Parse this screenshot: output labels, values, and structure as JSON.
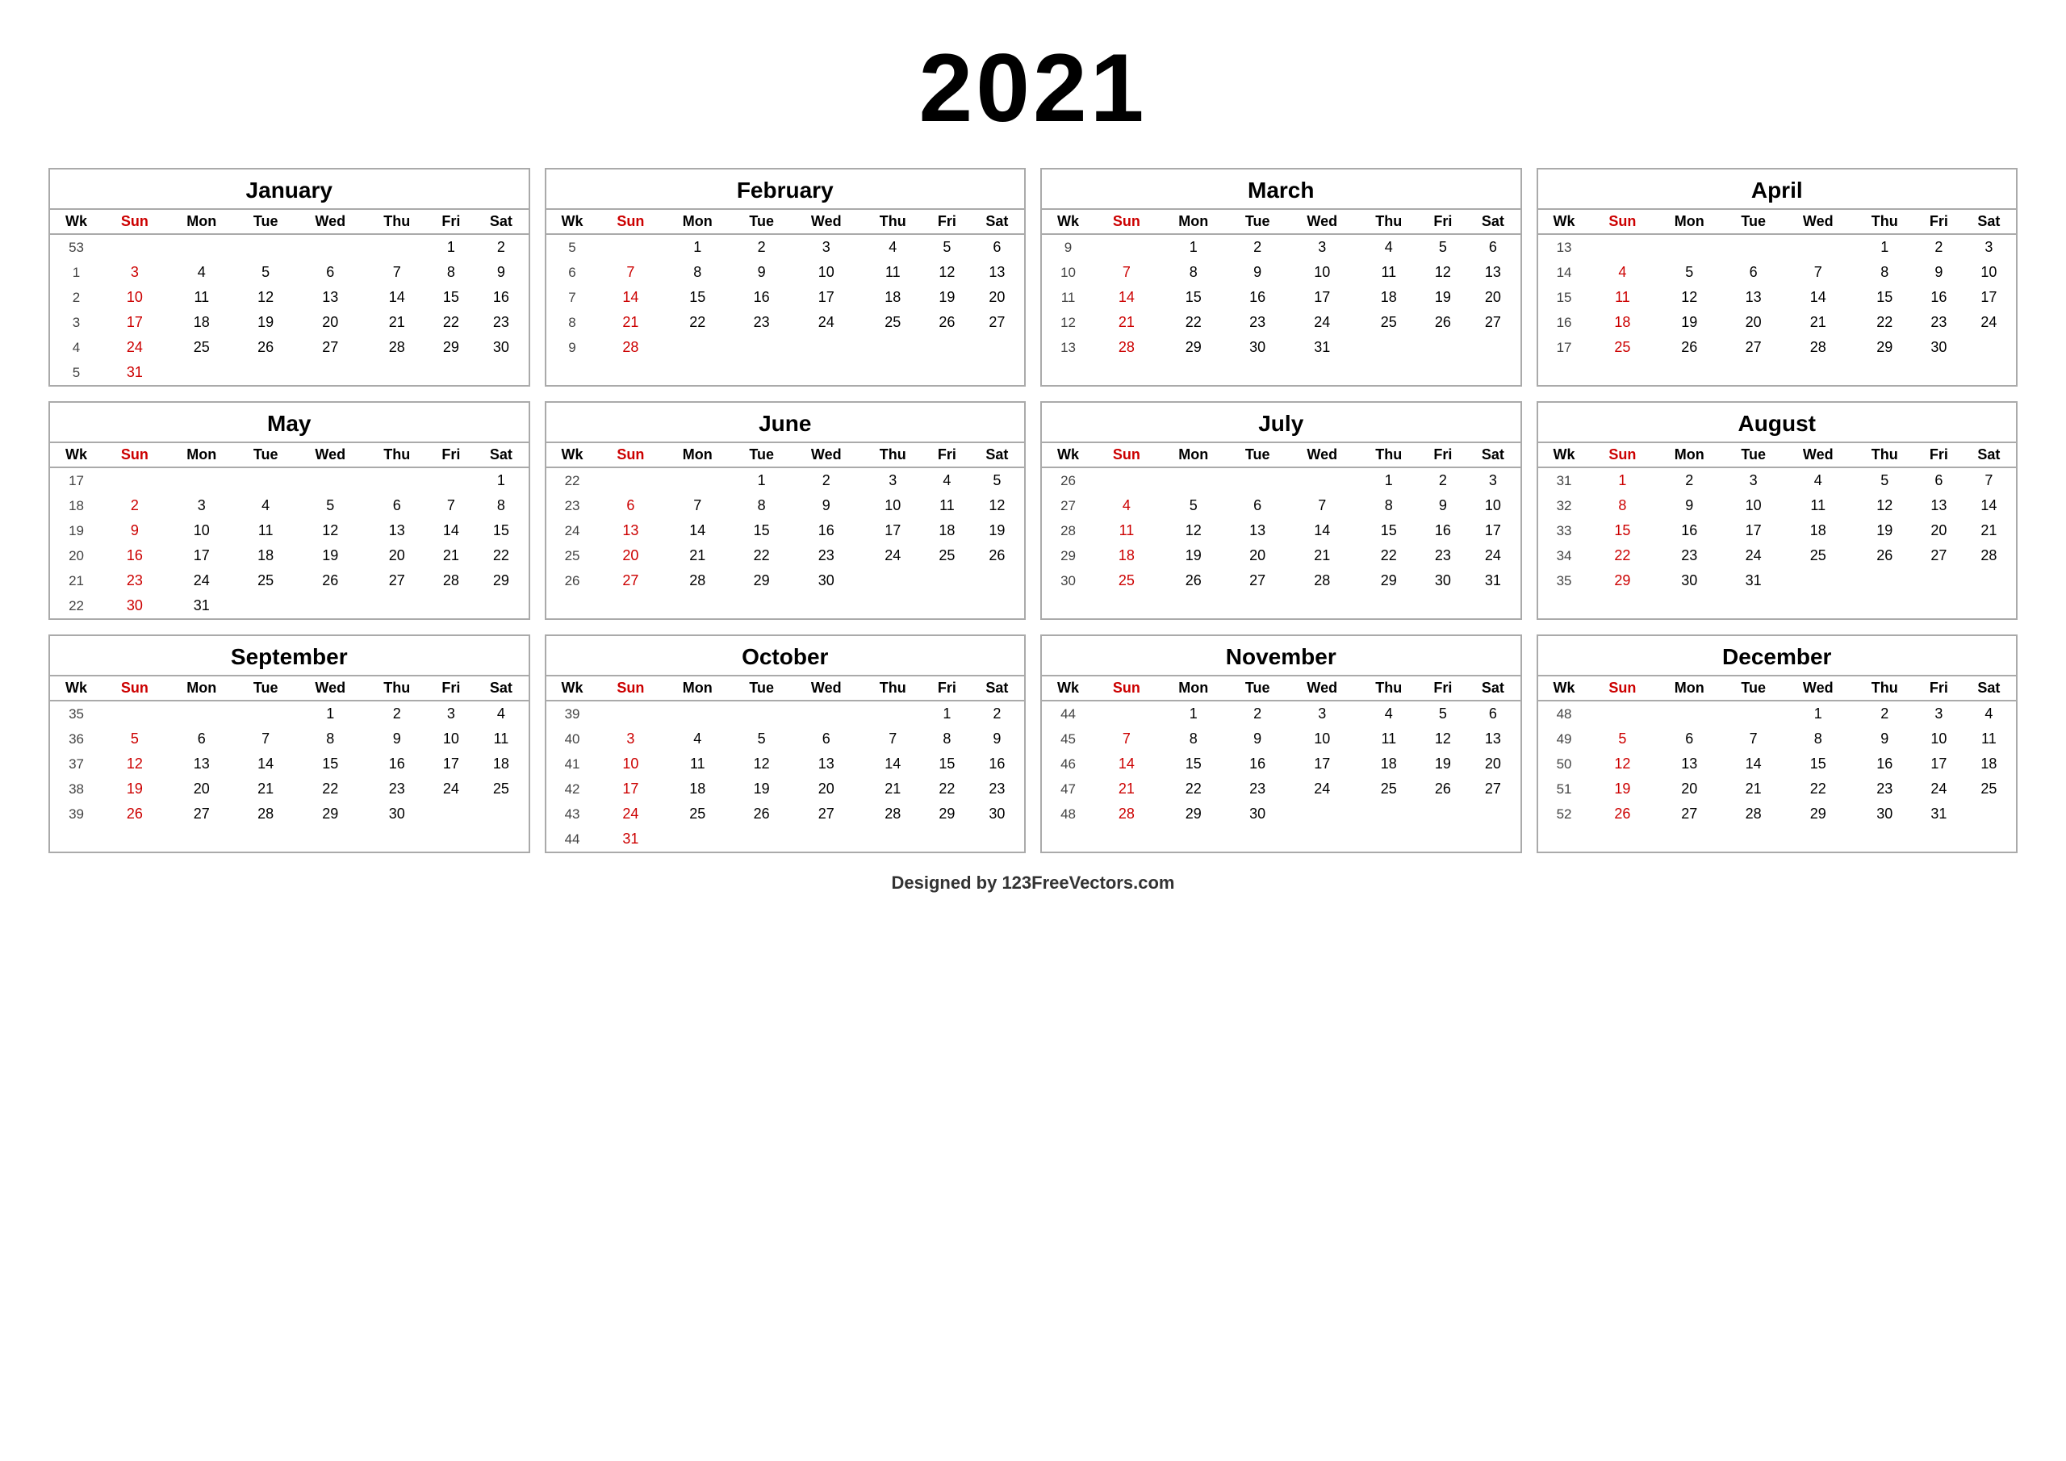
{
  "year": "2021",
  "months": [
    {
      "name": "January",
      "weeks": [
        {
          "wk": "53",
          "days": [
            "",
            "",
            "",
            "",
            "",
            "1",
            "2"
          ]
        },
        {
          "wk": "1",
          "days": [
            "3",
            "4",
            "5",
            "6",
            "7",
            "8",
            "9"
          ]
        },
        {
          "wk": "2",
          "days": [
            "10",
            "11",
            "12",
            "13",
            "14",
            "15",
            "16"
          ]
        },
        {
          "wk": "3",
          "days": [
            "17",
            "18",
            "19",
            "20",
            "21",
            "22",
            "23"
          ]
        },
        {
          "wk": "4",
          "days": [
            "24",
            "25",
            "26",
            "27",
            "28",
            "29",
            "30"
          ]
        },
        {
          "wk": "5",
          "days": [
            "31",
            "",
            "",
            "",
            "",
            "",
            ""
          ]
        }
      ]
    },
    {
      "name": "February",
      "weeks": [
        {
          "wk": "5",
          "days": [
            "",
            "1",
            "2",
            "3",
            "4",
            "5",
            "6"
          ]
        },
        {
          "wk": "6",
          "days": [
            "7",
            "8",
            "9",
            "10",
            "11",
            "12",
            "13"
          ]
        },
        {
          "wk": "7",
          "days": [
            "14",
            "15",
            "16",
            "17",
            "18",
            "19",
            "20"
          ]
        },
        {
          "wk": "8",
          "days": [
            "21",
            "22",
            "23",
            "24",
            "25",
            "26",
            "27"
          ]
        },
        {
          "wk": "9",
          "days": [
            "28",
            "",
            "",
            "",
            "",
            "",
            ""
          ]
        },
        {
          "wk": "",
          "days": [
            "",
            "",
            "",
            "",
            "",
            "",
            ""
          ]
        }
      ]
    },
    {
      "name": "March",
      "weeks": [
        {
          "wk": "9",
          "days": [
            "",
            "1",
            "2",
            "3",
            "4",
            "5",
            "6"
          ]
        },
        {
          "wk": "10",
          "days": [
            "7",
            "8",
            "9",
            "10",
            "11",
            "12",
            "13"
          ]
        },
        {
          "wk": "11",
          "days": [
            "14",
            "15",
            "16",
            "17",
            "18",
            "19",
            "20"
          ]
        },
        {
          "wk": "12",
          "days": [
            "21",
            "22",
            "23",
            "24",
            "25",
            "26",
            "27"
          ]
        },
        {
          "wk": "13",
          "days": [
            "28",
            "29",
            "30",
            "31",
            "",
            "",
            ""
          ]
        },
        {
          "wk": "",
          "days": [
            "",
            "",
            "",
            "",
            "",
            "",
            ""
          ]
        }
      ]
    },
    {
      "name": "April",
      "weeks": [
        {
          "wk": "13",
          "days": [
            "",
            "",
            "",
            "",
            "1",
            "2",
            "3"
          ]
        },
        {
          "wk": "14",
          "days": [
            "4",
            "5",
            "6",
            "7",
            "8",
            "9",
            "10"
          ]
        },
        {
          "wk": "15",
          "days": [
            "11",
            "12",
            "13",
            "14",
            "15",
            "16",
            "17"
          ]
        },
        {
          "wk": "16",
          "days": [
            "18",
            "19",
            "20",
            "21",
            "22",
            "23",
            "24"
          ]
        },
        {
          "wk": "17",
          "days": [
            "25",
            "26",
            "27",
            "28",
            "29",
            "30",
            ""
          ]
        },
        {
          "wk": "",
          "days": [
            "",
            "",
            "",
            "",
            "",
            "",
            ""
          ]
        }
      ]
    },
    {
      "name": "May",
      "weeks": [
        {
          "wk": "17",
          "days": [
            "",
            "",
            "",
            "",
            "",
            "",
            "1"
          ]
        },
        {
          "wk": "18",
          "days": [
            "2",
            "3",
            "4",
            "5",
            "6",
            "7",
            "8"
          ]
        },
        {
          "wk": "19",
          "days": [
            "9",
            "10",
            "11",
            "12",
            "13",
            "14",
            "15"
          ]
        },
        {
          "wk": "20",
          "days": [
            "16",
            "17",
            "18",
            "19",
            "20",
            "21",
            "22"
          ]
        },
        {
          "wk": "21",
          "days": [
            "23",
            "24",
            "25",
            "26",
            "27",
            "28",
            "29"
          ]
        },
        {
          "wk": "22",
          "days": [
            "30",
            "31",
            "",
            "",
            "",
            "",
            ""
          ]
        }
      ]
    },
    {
      "name": "June",
      "weeks": [
        {
          "wk": "22",
          "days": [
            "",
            "",
            "1",
            "2",
            "3",
            "4",
            "5"
          ]
        },
        {
          "wk": "23",
          "days": [
            "6",
            "7",
            "8",
            "9",
            "10",
            "11",
            "12"
          ]
        },
        {
          "wk": "24",
          "days": [
            "13",
            "14",
            "15",
            "16",
            "17",
            "18",
            "19"
          ]
        },
        {
          "wk": "25",
          "days": [
            "20",
            "21",
            "22",
            "23",
            "24",
            "25",
            "26"
          ]
        },
        {
          "wk": "26",
          "days": [
            "27",
            "28",
            "29",
            "30",
            "",
            "",
            ""
          ]
        },
        {
          "wk": "",
          "days": [
            "",
            "",
            "",
            "",
            "",
            "",
            ""
          ]
        }
      ]
    },
    {
      "name": "July",
      "weeks": [
        {
          "wk": "26",
          "days": [
            "",
            "",
            "",
            "",
            "1",
            "2",
            "3"
          ]
        },
        {
          "wk": "27",
          "days": [
            "4",
            "5",
            "6",
            "7",
            "8",
            "9",
            "10"
          ]
        },
        {
          "wk": "28",
          "days": [
            "11",
            "12",
            "13",
            "14",
            "15",
            "16",
            "17"
          ]
        },
        {
          "wk": "29",
          "days": [
            "18",
            "19",
            "20",
            "21",
            "22",
            "23",
            "24"
          ]
        },
        {
          "wk": "30",
          "days": [
            "25",
            "26",
            "27",
            "28",
            "29",
            "30",
            "31"
          ]
        },
        {
          "wk": "",
          "days": [
            "",
            "",
            "",
            "",
            "",
            "",
            ""
          ]
        }
      ]
    },
    {
      "name": "August",
      "weeks": [
        {
          "wk": "31",
          "days": [
            "1",
            "2",
            "3",
            "4",
            "5",
            "6",
            "7"
          ]
        },
        {
          "wk": "32",
          "days": [
            "8",
            "9",
            "10",
            "11",
            "12",
            "13",
            "14"
          ]
        },
        {
          "wk": "33",
          "days": [
            "15",
            "16",
            "17",
            "18",
            "19",
            "20",
            "21"
          ]
        },
        {
          "wk": "34",
          "days": [
            "22",
            "23",
            "24",
            "25",
            "26",
            "27",
            "28"
          ]
        },
        {
          "wk": "35",
          "days": [
            "29",
            "30",
            "31",
            "",
            "",
            "",
            ""
          ]
        },
        {
          "wk": "",
          "days": [
            "",
            "",
            "",
            "",
            "",
            "",
            ""
          ]
        }
      ]
    },
    {
      "name": "September",
      "weeks": [
        {
          "wk": "35",
          "days": [
            "",
            "",
            "",
            "1",
            "2",
            "3",
            "4"
          ]
        },
        {
          "wk": "36",
          "days": [
            "5",
            "6",
            "7",
            "8",
            "9",
            "10",
            "11"
          ]
        },
        {
          "wk": "37",
          "days": [
            "12",
            "13",
            "14",
            "15",
            "16",
            "17",
            "18"
          ]
        },
        {
          "wk": "38",
          "days": [
            "19",
            "20",
            "21",
            "22",
            "23",
            "24",
            "25"
          ]
        },
        {
          "wk": "39",
          "days": [
            "26",
            "27",
            "28",
            "29",
            "30",
            "",
            ""
          ]
        },
        {
          "wk": "",
          "days": [
            "",
            "",
            "",
            "",
            "",
            "",
            ""
          ]
        }
      ]
    },
    {
      "name": "October",
      "weeks": [
        {
          "wk": "39",
          "days": [
            "",
            "",
            "",
            "",
            "",
            "1",
            "2"
          ]
        },
        {
          "wk": "40",
          "days": [
            "3",
            "4",
            "5",
            "6",
            "7",
            "8",
            "9"
          ]
        },
        {
          "wk": "41",
          "days": [
            "10",
            "11",
            "12",
            "13",
            "14",
            "15",
            "16"
          ]
        },
        {
          "wk": "42",
          "days": [
            "17",
            "18",
            "19",
            "20",
            "21",
            "22",
            "23"
          ]
        },
        {
          "wk": "43",
          "days": [
            "24",
            "25",
            "26",
            "27",
            "28",
            "29",
            "30"
          ]
        },
        {
          "wk": "44",
          "days": [
            "31",
            "",
            "",
            "",
            "",
            "",
            ""
          ]
        }
      ]
    },
    {
      "name": "November",
      "weeks": [
        {
          "wk": "44",
          "days": [
            "",
            "1",
            "2",
            "3",
            "4",
            "5",
            "6"
          ]
        },
        {
          "wk": "45",
          "days": [
            "7",
            "8",
            "9",
            "10",
            "11",
            "12",
            "13"
          ]
        },
        {
          "wk": "46",
          "days": [
            "14",
            "15",
            "16",
            "17",
            "18",
            "19",
            "20"
          ]
        },
        {
          "wk": "47",
          "days": [
            "21",
            "22",
            "23",
            "24",
            "25",
            "26",
            "27"
          ]
        },
        {
          "wk": "48",
          "days": [
            "28",
            "29",
            "30",
            "",
            "",
            "",
            ""
          ]
        },
        {
          "wk": "",
          "days": [
            "",
            "",
            "",
            "",
            "",
            "",
            ""
          ]
        }
      ]
    },
    {
      "name": "December",
      "weeks": [
        {
          "wk": "48",
          "days": [
            "",
            "",
            "",
            "1",
            "2",
            "3",
            "4"
          ]
        },
        {
          "wk": "49",
          "days": [
            "5",
            "6",
            "7",
            "8",
            "9",
            "10",
            "11"
          ]
        },
        {
          "wk": "50",
          "days": [
            "12",
            "13",
            "14",
            "15",
            "16",
            "17",
            "18"
          ]
        },
        {
          "wk": "51",
          "days": [
            "19",
            "20",
            "21",
            "22",
            "23",
            "24",
            "25"
          ]
        },
        {
          "wk": "52",
          "days": [
            "26",
            "27",
            "28",
            "29",
            "30",
            "31",
            ""
          ]
        },
        {
          "wk": "",
          "days": [
            "",
            "",
            "",
            "",
            "",
            "",
            ""
          ]
        }
      ]
    }
  ],
  "dayHeaders": [
    "Wk",
    "Sun",
    "Mon",
    "Tue",
    "Wed",
    "Thu",
    "Fri",
    "Sat"
  ],
  "footer": {
    "text": "Designed by ",
    "brand": "123FreeVectors.com"
  }
}
